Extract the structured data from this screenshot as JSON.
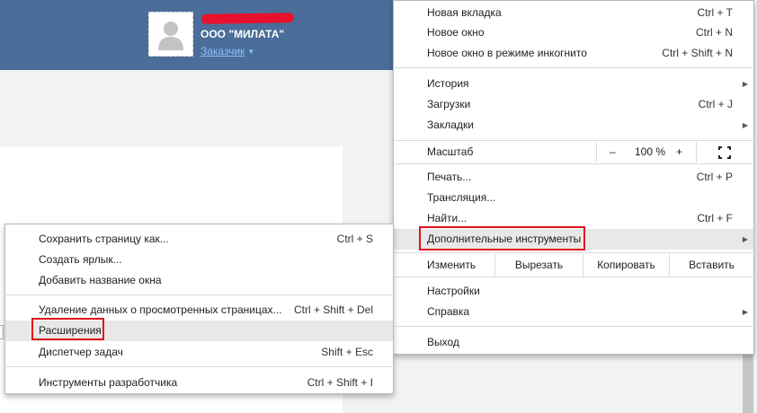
{
  "header": {
    "company": "ООО \"МИЛАТА\"",
    "role": "Заказчик",
    "caret": "▼"
  },
  "main_menu": {
    "new_tab": {
      "label": "Новая вкладка",
      "shortcut": "Ctrl + T"
    },
    "new_window": {
      "label": "Новое окно",
      "shortcut": "Ctrl + N"
    },
    "incognito": {
      "label": "Новое окно в режиме инкогнито",
      "shortcut": "Ctrl + Shift + N"
    },
    "history": {
      "label": "История"
    },
    "downloads": {
      "label": "Загрузки",
      "shortcut": "Ctrl + J"
    },
    "bookmarks": {
      "label": "Закладки"
    },
    "zoom": {
      "label": "Масштаб",
      "minus": "–",
      "value": "100 %",
      "plus": "+"
    },
    "print": {
      "label": "Печать...",
      "shortcut": "Ctrl + P"
    },
    "cast": {
      "label": "Трансляция..."
    },
    "find": {
      "label": "Найти...",
      "shortcut": "Ctrl + F"
    },
    "more_tools": {
      "label": "Дополнительные инструменты"
    },
    "edit": {
      "label": "Изменить",
      "cut": "Вырезать",
      "copy": "Копировать",
      "paste": "Вставить"
    },
    "settings": {
      "label": "Настройки"
    },
    "help": {
      "label": "Справка"
    },
    "exit": {
      "label": "Выход"
    },
    "submenu_arrow": "▶"
  },
  "sub_menu": {
    "save_page": {
      "label": "Сохранить страницу как...",
      "shortcut": "Ctrl + S"
    },
    "create_shortcut": {
      "label": "Создать ярлык..."
    },
    "add_window_name": {
      "label": "Добавить название окна"
    },
    "clear_data": {
      "label": "Удаление данных о просмотренных страницах...",
      "shortcut": "Ctrl + Shift + Del"
    },
    "extensions": {
      "label": "Расширения"
    },
    "task_manager": {
      "label": "Диспетчер задач",
      "shortcut": "Shift + Esc"
    },
    "dev_tools": {
      "label": "Инструменты разработчика",
      "shortcut": "Ctrl + Shift + I"
    }
  },
  "colors": {
    "header_bg": "#4a6d99",
    "role_link": "#8fc0ff",
    "highlight_box": "#e0101e",
    "redaction": "#e8112d"
  }
}
